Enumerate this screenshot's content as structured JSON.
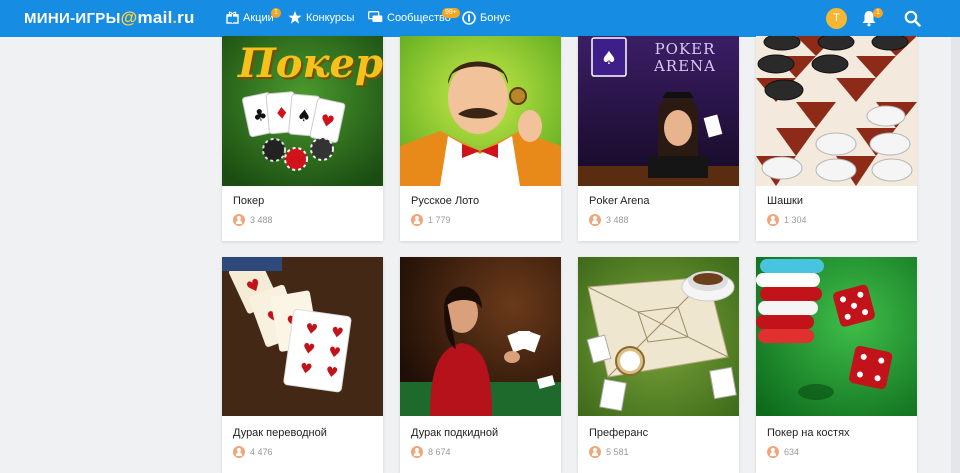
{
  "header": {
    "logo": {
      "part1": "МИНИ-ИГРЫ",
      "at": "@",
      "part2": "mail",
      "dot": ".",
      "part3": "ru"
    },
    "nav": [
      {
        "label": "Акции",
        "icon": "gift-icon",
        "badge": "1"
      },
      {
        "label": "Конкурсы",
        "icon": "star-icon",
        "badge": ""
      },
      {
        "label": "Сообщество",
        "icon": "chat-icon",
        "badge": "99+"
      },
      {
        "label": "Бонус",
        "icon": "bonus-coin-icon",
        "badge": ""
      }
    ],
    "avatar_letter": "Т",
    "notifications_badge": "1",
    "colors": {
      "bar": "#168de2",
      "accent": "#f5a623"
    }
  },
  "games": [
    {
      "title": "Покер",
      "players": "3 488",
      "art_text": "Покер"
    },
    {
      "title": "Русское Лото",
      "players": "1 779"
    },
    {
      "title": "Poker Arena",
      "players": "3 488",
      "art_text": "POKER ARENA"
    },
    {
      "title": "Шашки",
      "players": "1 304"
    },
    {
      "title": "Дурак переводной",
      "players": "4 476"
    },
    {
      "title": "Дурак подкидной",
      "players": "8 674"
    },
    {
      "title": "Преферанс",
      "players": "5 581"
    },
    {
      "title": "Покер на костях",
      "players": "634"
    }
  ]
}
